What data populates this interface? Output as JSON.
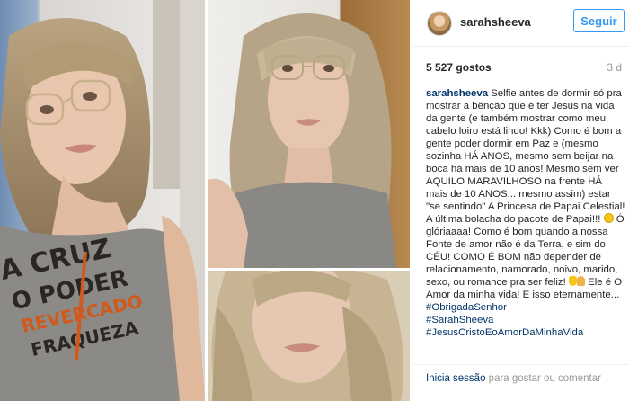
{
  "header": {
    "username": "sarahsheeva",
    "follow_label": "Seguir"
  },
  "stats": {
    "likes": "5 527 gostos",
    "time": "3 d"
  },
  "caption": {
    "username": "sarahsheeva",
    "part1": "Selfie antes de dormir só pra mostrar a bênção que é ter Jesus na vida da gente (e também mostrar como meu cabelo loiro está lindo! Kkk) Como é bom a gente poder dormir em Paz e (mesmo sozinha HÁ ANOS, mesmo sem beijar na boca há mais de 10 anos! Mesmo sem ver AQUILO MARAVILHOSO na frente HÁ mais de 10 ANOS... mesmo assim) estar \"se sentindo\" A Princesa de Papai Celestial! A última bolacha do pacote de Papai!!!",
    "part2": "Ó glóriaaaa!",
    "part3": "Como é bom quando a nossa Fonte de amor não é da Terra, e sim do CÉU! COMO É BOM não depender de relacionamento, namorado, noivo, marido, sexo, ou romance pra ser feliz!",
    "part4": "Ele é O Amor da minha vida! E isso eternamente...",
    "hashtag1": "#ObrigadaSenhor",
    "hashtag2": "#SarahSheeva",
    "hashtag3": "#JesusCristoEoAmorDaMinhaVida"
  },
  "footer": {
    "login_link": "Inicia sessão",
    "rest": " para gostar ou comentar"
  },
  "shirt_text": {
    "line1": "A CRUZ",
    "line2": "O PODER",
    "line3": "REVERCADO",
    "line4": "FRAQUEZA"
  },
  "colors": {
    "link": "#003569",
    "follow": "#3897f0",
    "muted": "#999999",
    "text": "#262626"
  }
}
